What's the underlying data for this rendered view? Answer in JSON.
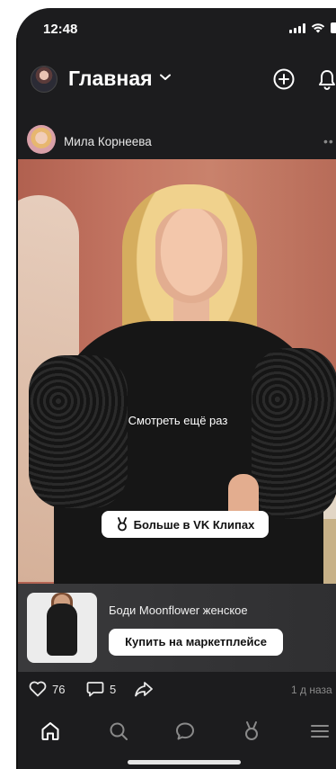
{
  "status_bar": {
    "time": "12:48"
  },
  "header": {
    "title": "Главная"
  },
  "post": {
    "author": "Мила Корнеева",
    "more": "••",
    "video": {
      "clips_button": "Больше в VK Клипах",
      "replay": "Смотреть ещё раз"
    },
    "product": {
      "title": "Боди Moonflower женское",
      "buy_button": "Купить на маркетплейсе"
    },
    "likes": "76",
    "comments": "5",
    "time_ago": "1 д наза"
  },
  "tabbar": {
    "items": [
      "home-icon",
      "search-icon",
      "messages-icon",
      "clips-icon",
      "menu-icon"
    ],
    "active": "home-icon"
  },
  "colors": {
    "background": "#1c1c1e",
    "text": "#ffffff",
    "muted": "#8a8a8a",
    "button_bg": "#ffffff",
    "button_text": "#111111"
  }
}
